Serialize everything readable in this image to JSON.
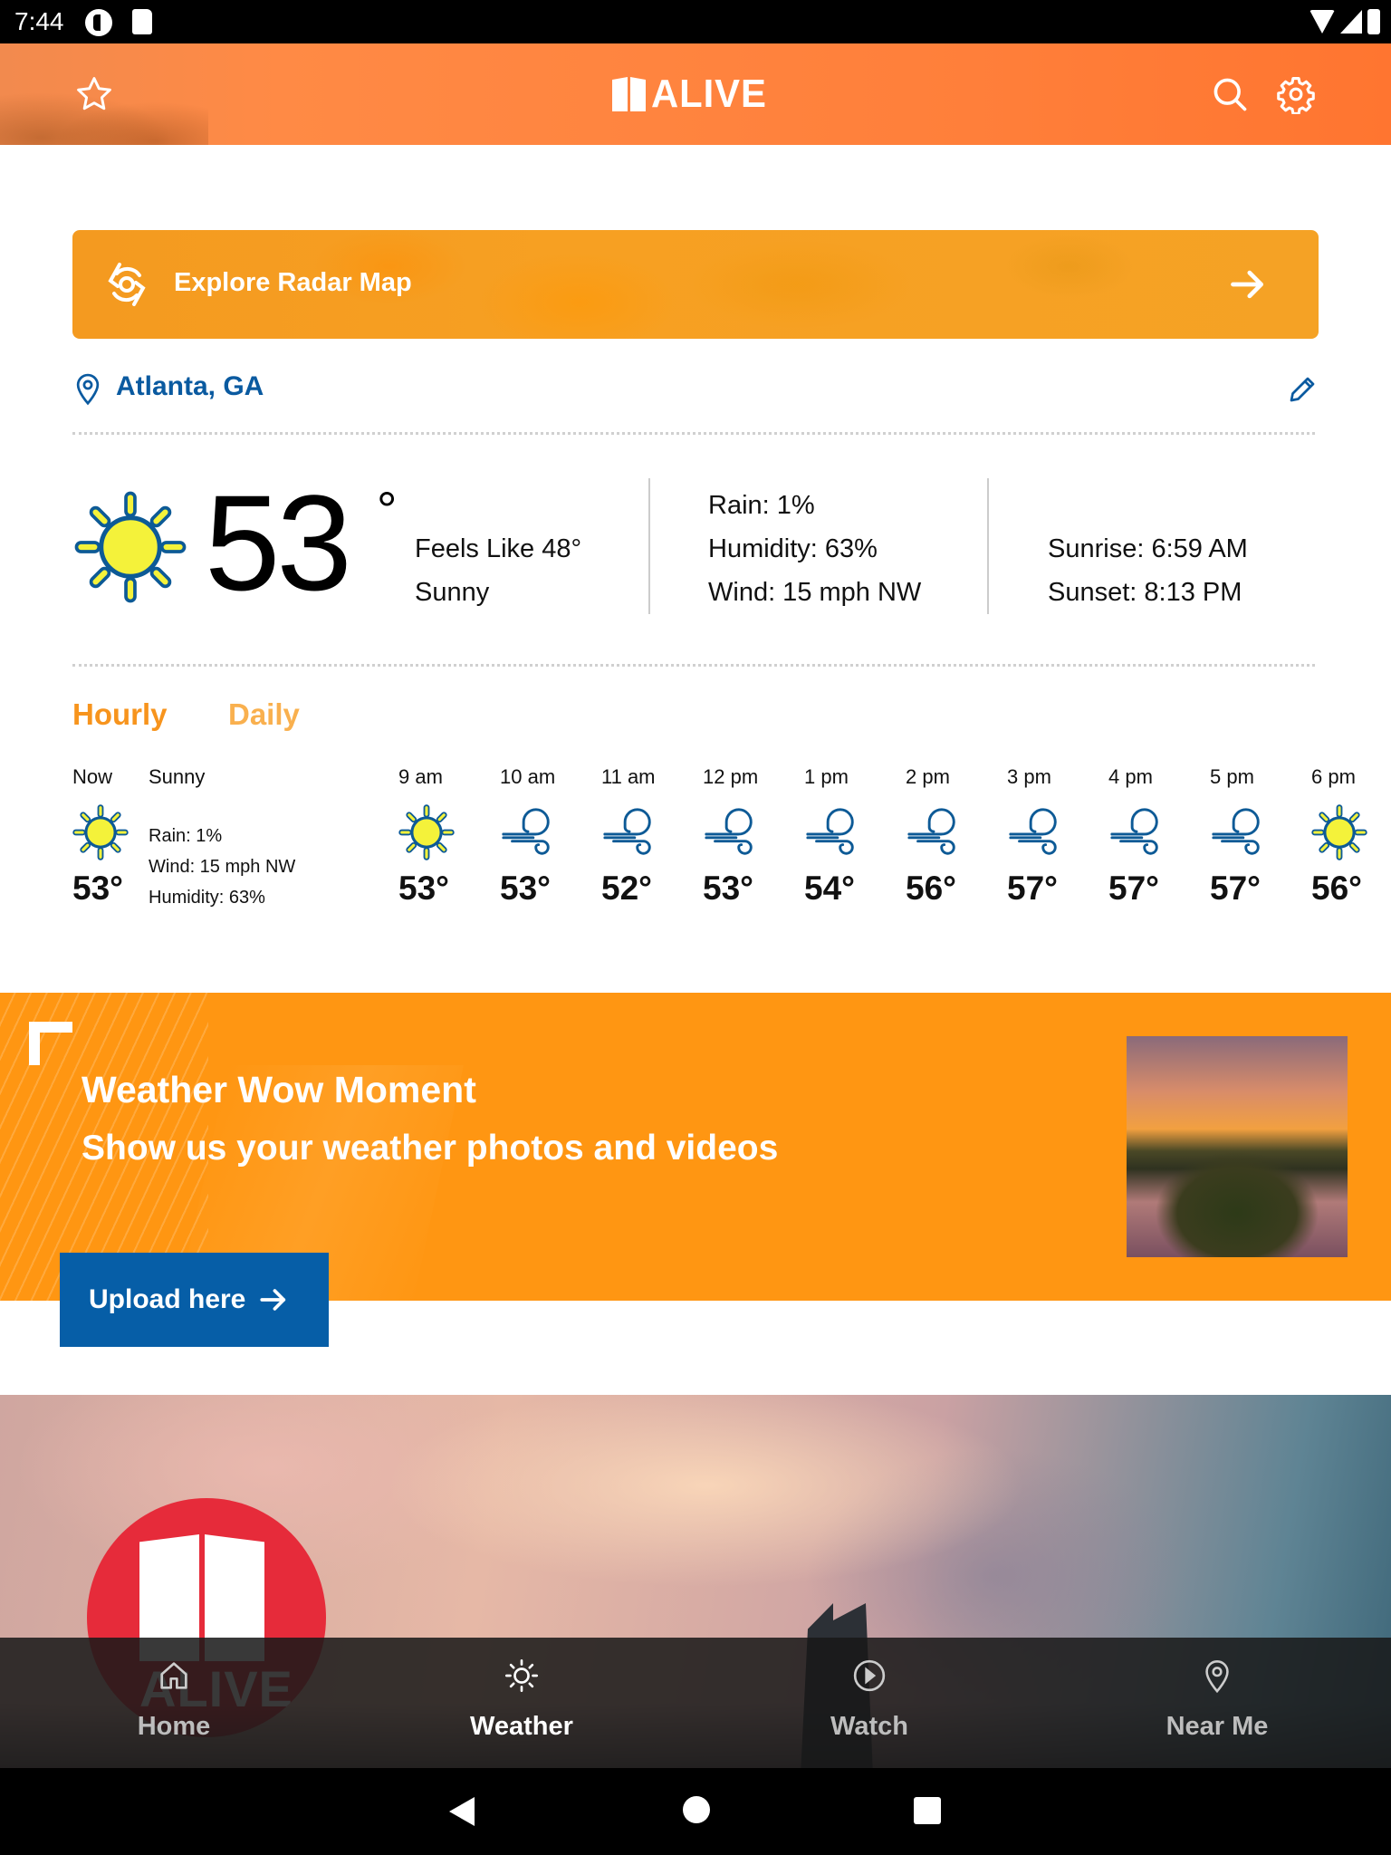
{
  "status_bar": {
    "time": "7:44"
  },
  "header": {
    "logo_text": "ALIVE",
    "icons": [
      "star-icon",
      "search-icon",
      "gear-icon"
    ]
  },
  "radar": {
    "label": "Explore Radar Map",
    "icon": "radar-icon",
    "arrow": "arrow-right-icon"
  },
  "location": {
    "name": "Atlanta, GA",
    "pin_icon": "location-pin-icon",
    "edit_icon": "pencil-icon"
  },
  "current": {
    "temp": "53",
    "degree": "°",
    "feels_like": "Feels Like 48°",
    "condition": "Sunny",
    "rain": "Rain: 1%",
    "humidity": "Humidity: 63%",
    "wind": "Wind: 15 mph NW",
    "sunrise": "Sunrise: 6:59 AM",
    "sunset": "Sunset: 8:13 PM",
    "icon": "sun-icon"
  },
  "tabs": [
    {
      "label": "Hourly",
      "active": true
    },
    {
      "label": "Daily",
      "active": false
    }
  ],
  "hourly_now": {
    "label": "Now",
    "condition": "Sunny",
    "temp": "53°",
    "rain": "Rain: 1%",
    "wind": "Wind: 15 mph NW",
    "humidity": "Humidity: 63%",
    "icon": "sun-icon"
  },
  "hourly": [
    {
      "time": "9 am",
      "temp": "53°",
      "icon": "sun"
    },
    {
      "time": "10 am",
      "temp": "53°",
      "icon": "wind"
    },
    {
      "time": "11 am",
      "temp": "52°",
      "icon": "wind"
    },
    {
      "time": "12 pm",
      "temp": "53°",
      "icon": "wind"
    },
    {
      "time": "1 pm",
      "temp": "54°",
      "icon": "wind"
    },
    {
      "time": "2 pm",
      "temp": "56°",
      "icon": "wind"
    },
    {
      "time": "3 pm",
      "temp": "57°",
      "icon": "wind"
    },
    {
      "time": "4 pm",
      "temp": "57°",
      "icon": "wind"
    },
    {
      "time": "5 pm",
      "temp": "57°",
      "icon": "wind"
    },
    {
      "time": "6 pm",
      "temp": "56°",
      "icon": "sun"
    }
  ],
  "promo": {
    "title": "Weather Wow Moment",
    "subtitle": "Show us your weather photos and videos",
    "button_label": "Upload here"
  },
  "hero": {
    "logo_text": "ALIVE"
  },
  "bottom_nav": [
    {
      "label": "Home",
      "icon": "home-icon",
      "active": false
    },
    {
      "label": "Weather",
      "icon": "sun-outline-icon",
      "active": true
    },
    {
      "label": "Watch",
      "icon": "play-circle-icon",
      "active": false
    },
    {
      "label": "Near Me",
      "icon": "location-pin-icon",
      "active": false
    }
  ],
  "colors": {
    "header_orange": "#ff7f3a",
    "radar_orange": "#f7a022",
    "accent_orange": "#f7941d",
    "link_blue": "#0a5aa0",
    "promo_orange": "#ff9612",
    "button_blue": "#065ea7",
    "sun_yellow": "#f4f23a",
    "icon_blue": "#0d5a96"
  }
}
